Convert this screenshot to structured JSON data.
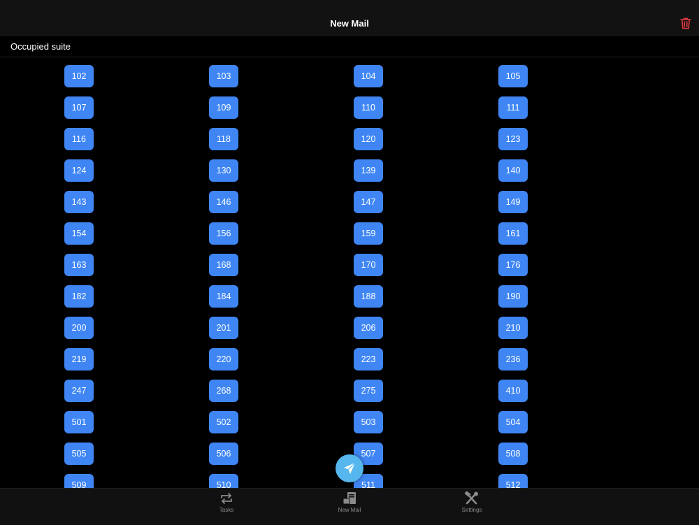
{
  "navbar": {
    "title": "New Mail",
    "delete_icon": "trash-icon",
    "delete_color": "#e0393e"
  },
  "section": {
    "title": "Occupied suite"
  },
  "suites": [
    "102",
    "103",
    "104",
    "105",
    "107",
    "109",
    "110",
    "111",
    "116",
    "118",
    "120",
    "123",
    "124",
    "130",
    "139",
    "140",
    "143",
    "146",
    "147",
    "149",
    "154",
    "156",
    "159",
    "161",
    "163",
    "168",
    "170",
    "176",
    "182",
    "184",
    "188",
    "190",
    "200",
    "201",
    "206",
    "210",
    "219",
    "220",
    "223",
    "236",
    "247",
    "268",
    "275",
    "410",
    "501",
    "502",
    "503",
    "504",
    "505",
    "506",
    "507",
    "508",
    "509",
    "510",
    "511",
    "512"
  ],
  "colors": {
    "suite_button": "#3f86f4",
    "fab": "#56b7ee",
    "background": "#000000"
  },
  "fab": {
    "icon": "send-icon"
  },
  "tabbar": {
    "tabs": [
      {
        "label": "Tasks",
        "icon": "repeat-arrows-icon"
      },
      {
        "label": "New Mail",
        "icon": "mail-icon"
      },
      {
        "label": "Settings",
        "icon": "tools-icon"
      }
    ]
  }
}
